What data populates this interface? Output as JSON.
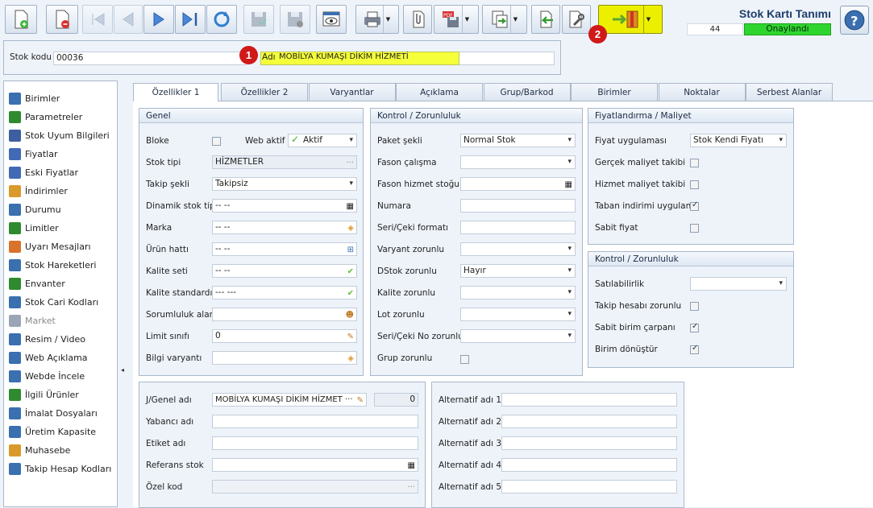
{
  "window": {
    "title": "Stok Kartı Tanımı",
    "record_no": "44",
    "status": "Onaylandı"
  },
  "toolbar": {
    "icons": [
      "new-doc-icon",
      "delete-doc-icon",
      "first-record-icon",
      "prev-record-icon",
      "next-record-icon",
      "last-record-icon",
      "refresh-icon",
      "save-icon",
      "save-close-icon",
      "preview-icon",
      "print-icon",
      "attach-icon",
      "pdf-export-icon",
      "transfer-icon",
      "import-icon",
      "tools-icon",
      "exit-door-icon",
      "help-icon"
    ],
    "badge1": "1",
    "badge2": "2"
  },
  "header": {
    "stok_kodu_label": "Stok kodu",
    "stok_kodu_value": "00036",
    "adi_label": "Adı",
    "adi_value": "MOBİLYA KUMAŞI DİKİM HİZMETİ"
  },
  "sidebar": {
    "items": [
      {
        "label": "Birimler",
        "icon": "units-icon",
        "color": "#3a6fb0"
      },
      {
        "label": "Parametreler",
        "icon": "parameters-icon",
        "color": "#2f8a2f"
      },
      {
        "label": "Stok Uyum Bilgileri",
        "icon": "compatibility-icon",
        "color": "#3b5fa0"
      },
      {
        "label": "Fiyatlar",
        "icon": "price-tag-icon",
        "color": "#4169b5"
      },
      {
        "label": "Eski Fiyatlar",
        "icon": "old-prices-icon",
        "color": "#4169b5"
      },
      {
        "label": "İndirimler",
        "icon": "discount-icon",
        "color": "#d99a2b"
      },
      {
        "label": "Durumu",
        "icon": "status-icon",
        "color": "#3a6fb0"
      },
      {
        "label": "Limitler",
        "icon": "limits-icon",
        "color": "#2f8a2f"
      },
      {
        "label": "Uyarı Mesajları",
        "icon": "warning-message-icon",
        "color": "#d9732b"
      },
      {
        "label": "Stok Hareketleri",
        "icon": "stock-movements-icon",
        "color": "#3a6fb0"
      },
      {
        "label": "Envanter",
        "icon": "inventory-icon",
        "color": "#2f8a2f"
      },
      {
        "label": "Stok Cari Kodları",
        "icon": "account-codes-icon",
        "color": "#3a6fb0"
      },
      {
        "label": "Market",
        "icon": "market-icon",
        "color": "#9aa6b5",
        "disabled": true
      },
      {
        "label": "Resim / Video",
        "icon": "image-video-icon",
        "color": "#3a6fb0"
      },
      {
        "label": "Web Açıklama",
        "icon": "web-description-icon",
        "color": "#3a6fb0"
      },
      {
        "label": "Webde İncele",
        "icon": "web-view-icon",
        "color": "#3a6fb0"
      },
      {
        "label": "İlgili Ürünler",
        "icon": "related-products-icon",
        "color": "#2f8a2f"
      },
      {
        "label": "İmalat Dosyaları",
        "icon": "manufacturing-files-icon",
        "color": "#3a6fb0"
      },
      {
        "label": "Üretim Kapasite",
        "icon": "production-capacity-icon",
        "color": "#3a6fb0"
      },
      {
        "label": "Muhasebe",
        "icon": "accounting-icon",
        "color": "#d99a2b"
      },
      {
        "label": "Takip Hesap Kodları",
        "icon": "tracking-codes-icon",
        "color": "#3a6fb0"
      }
    ]
  },
  "tabs": [
    "Özellikler 1",
    "Özellikler 2",
    "Varyantlar",
    "Açıklama",
    "Grup/Barkod",
    "Birimler",
    "Noktalar",
    "Serbest Alanlar"
  ],
  "genel": {
    "title": "Genel",
    "bloke": "Bloke",
    "web_aktif": "Web aktif",
    "web_aktif_value": "Aktif",
    "stok_tipi": "Stok tipi",
    "stok_tipi_value": "HİZMETLER",
    "takip_sekli": "Takip şekli",
    "takip_sekli_value": "Takipsiz",
    "dinamik": "Dinamik stok tipi",
    "dinamik_value": "-- --",
    "marka": "Marka",
    "marka_value": "-- --",
    "urun_hatti": "Ürün hattı",
    "urun_hatti_value": "-- --",
    "kalite_seti": "Kalite seti",
    "kalite_seti_value": "-- --",
    "kalite_std": "Kalite standardı",
    "kalite_std_value": "--- ---",
    "sorumluluk": "Sorumluluk alanı",
    "sorumluluk_value": "",
    "limit": "Limit sınıfı",
    "limit_value": "0",
    "bilgi": "Bilgi varyantı",
    "bilgi_value": ""
  },
  "kontrol": {
    "title": "Kontrol / Zorunluluk",
    "paket": "Paket şekli",
    "paket_value": "Normal Stok",
    "fason_calisma": "Fason çalışma",
    "fason_hizmet": "Fason hizmet stoğu",
    "numara": "Numara",
    "seri_format": "Seri/Çeki formatı",
    "varyant_zor": "Varyant zorunlu",
    "dstok": "DStok zorunlu",
    "dstok_value": "Hayır",
    "kalite_zor": "Kalite zorunlu",
    "lot_zor": "Lot zorunlu",
    "seri_no_zor": "Seri/Çeki No zorunlu",
    "grup_zor": "Grup zorunlu"
  },
  "fiyat": {
    "title": "Fiyatlandırma / Maliyet",
    "fiyat_uyg": "Fiyat uygulaması",
    "fiyat_uyg_value": "Stok Kendi Fiyatı",
    "gercek": "Gerçek maliyet takibi",
    "hizmet": "Hizmet maliyet takibi",
    "taban": "Taban indirimi uygulanır",
    "sabit": "Sabit fiyat"
  },
  "kontrol2": {
    "title": "Kontrol / Zorunluluk",
    "satilabilirlik": "Satılabilirlik",
    "takip_hesabi": "Takip hesabı zorunlu",
    "sabit_birim": "Sabit birim çarpanı",
    "birim_donustur": "Birim dönüştür"
  },
  "adlar": {
    "jgenel": "J/Genel adı",
    "jgenel_value": "MOBİLYA KUMAŞI DİKİM HİZMET ···",
    "jgenel_num": "0",
    "yabanci": "Yabancı adı",
    "etiket": "Etiket adı",
    "referans": "Referans stok",
    "ozel": "Özel kod"
  },
  "alternatif": {
    "labels": [
      "Alternatif adı 1",
      "Alternatif adı 2",
      "Alternatif adı 3",
      "Alternatif adı 4",
      "Alternatif adı 5"
    ]
  }
}
